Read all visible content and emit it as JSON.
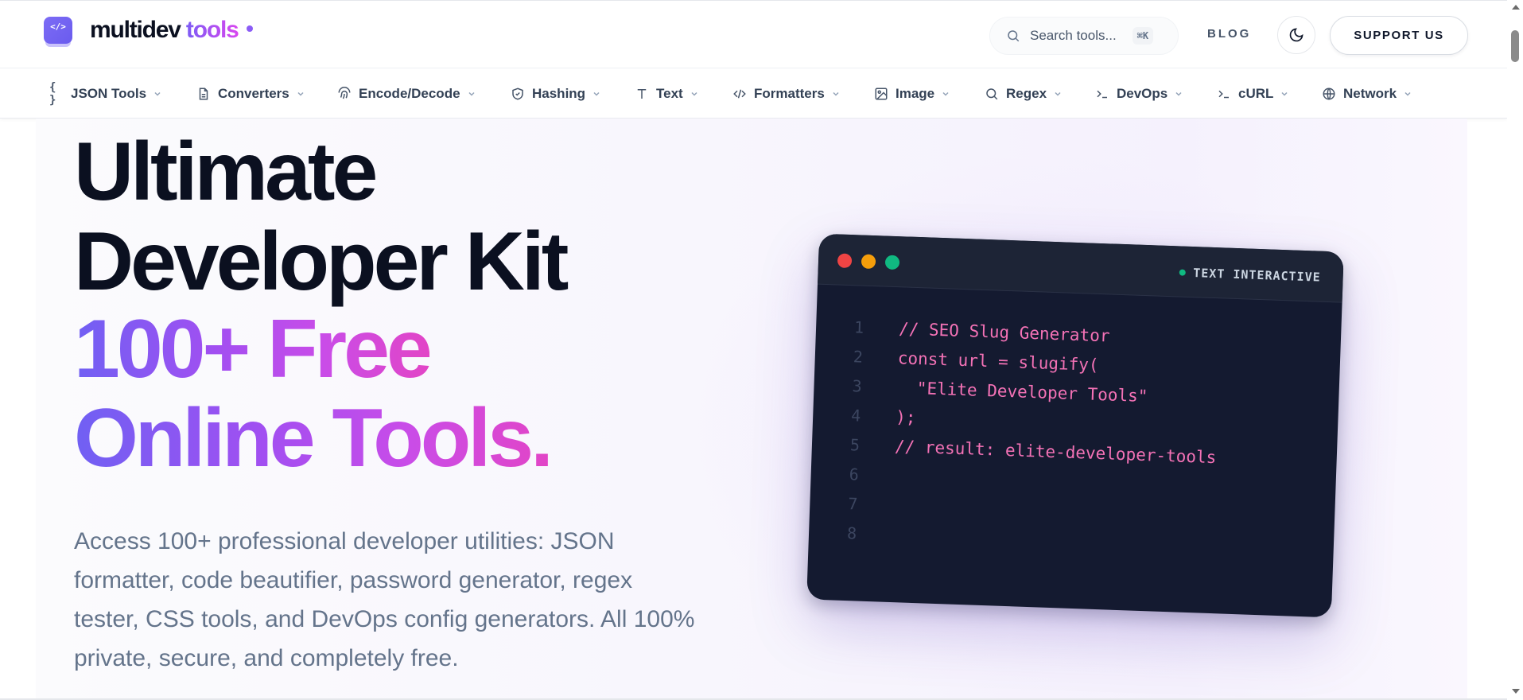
{
  "header": {
    "logo_glyph": "</>",
    "logo_main": "multidev",
    "logo_accent": "tools",
    "search_placeholder": "Search tools...",
    "search_shortcut": "⌘K",
    "blog_label": "BLOG",
    "support_label": "SUPPORT US"
  },
  "nav": {
    "items": [
      {
        "label": "JSON Tools",
        "icon": "{ }"
      },
      {
        "label": "Converters",
        "icon": "file-icon"
      },
      {
        "label": "Encode/Decode",
        "icon": "fingerprint-icon"
      },
      {
        "label": "Hashing",
        "icon": "shield-icon"
      },
      {
        "label": "Text",
        "icon": "T"
      },
      {
        "label": "Formatters",
        "icon": "</>"
      },
      {
        "label": "Image",
        "icon": "image-icon"
      },
      {
        "label": "Regex",
        "icon": "search-icon"
      },
      {
        "label": "DevOps",
        "icon": ">_"
      },
      {
        "label": "cURL",
        "icon": ">_"
      },
      {
        "label": "Network",
        "icon": "globe-icon"
      }
    ]
  },
  "hero": {
    "title_line1": "Ultimate",
    "title_line2": "Developer Kit",
    "title_line3": "100+ Free",
    "title_line4": "Online Tools.",
    "description": "Access 100+ professional developer utilities: JSON formatter, code beautifier, password generator, regex tester, CSS tools, and DevOps config generators. All 100% private, secure, and completely free."
  },
  "code_window": {
    "status_label": "TEXT INTERACTIVE",
    "line_numbers": [
      "1",
      "2",
      "3",
      "4",
      "5",
      "6",
      "7",
      "8"
    ],
    "lines": [
      "// SEO Slug Generator",
      "const url = slugify(",
      "  \"Elite Developer Tools\"",
      ");",
      "// result: elite-developer-tools"
    ]
  },
  "colors": {
    "accent_purple": "#8b5cf6",
    "accent_pink": "#e245c6",
    "code_text": "#f472b6",
    "window_bg": "#141a30",
    "dot_red": "#ef4444",
    "dot_yellow": "#f59e0b",
    "dot_green": "#10b981"
  }
}
